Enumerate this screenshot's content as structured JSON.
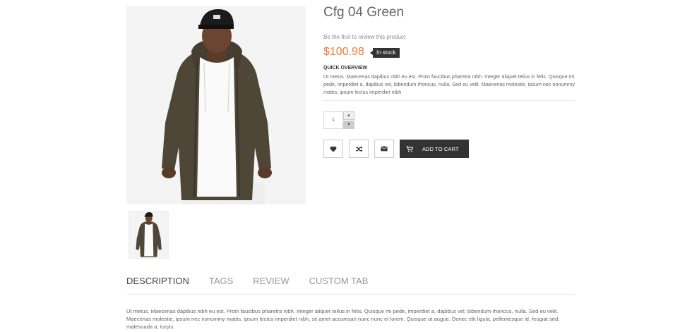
{
  "product": {
    "title": "Cfg 04 Green",
    "review_link": "Be the first to review this product",
    "price": "$100.98",
    "stock": "In stock",
    "quick_overview_title": "QUICK OVERVIEW",
    "quick_overview_text": "Ut metus. Maecenas dapibus nibh eu est. Proin faucibus pharetra nibh. Integer aliquet tellus in felis. Quisque mi pede, imperdiet a, dapibus vel, bibendum rhoncus, nulla. Sed eu velit. Maecenas molestie, ipsum nec nonummy mattis, ipsum lectus imperdiet nibh",
    "quantity": "1"
  },
  "actions": {
    "add_to_cart": "ADD TO CART",
    "wishlist_icon": "heart-icon",
    "compare_icon": "shuffle-icon",
    "email_icon": "envelope-icon",
    "cart_icon": "cart-icon"
  },
  "tabs": [
    {
      "label": "DESCRIPTION",
      "active": true
    },
    {
      "label": "TAGS",
      "active": false
    },
    {
      "label": "REVIEW",
      "active": false
    },
    {
      "label": "CUSTOM TAB",
      "active": false
    }
  ],
  "description": "Ut metus. Maecenas dapibus nibh eu est. Proin faucibus pharetra nibh. Integer aliquet tellus in felis. Quisque mi pede, imperdiet a, dapibus vel, bibendum rhoncus, nulla. Sed eu velit. Maecenas molestie, ipsum nec nonummy mattis, ipsum lectus imperdiet nibh, sit amet accumsan nunc nunc et lorem. Quisque at augue. Donec elit ligula, pellentesque id, feugiat sed, malesuada a, turpis.",
  "colors": {
    "price": "#f07c39",
    "stock_badge": "#333333",
    "cart_button": "#333333"
  }
}
